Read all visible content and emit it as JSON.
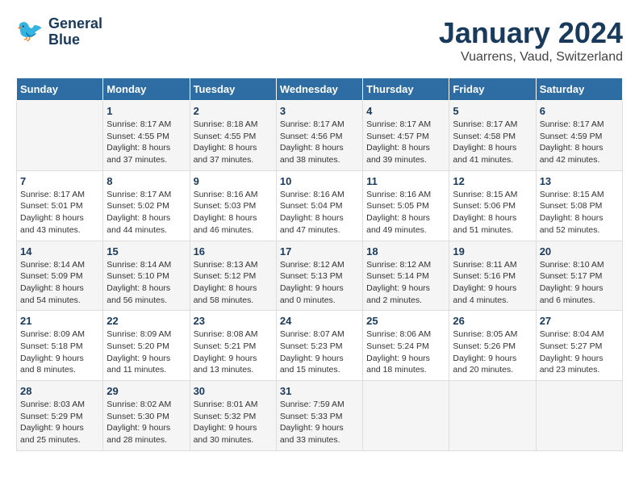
{
  "header": {
    "logo_line1": "General",
    "logo_line2": "Blue",
    "month": "January 2024",
    "location": "Vuarrens, Vaud, Switzerland"
  },
  "days_of_week": [
    "Sunday",
    "Monday",
    "Tuesday",
    "Wednesday",
    "Thursday",
    "Friday",
    "Saturday"
  ],
  "weeks": [
    [
      {
        "day": "",
        "info": ""
      },
      {
        "day": "1",
        "info": "Sunrise: 8:17 AM\nSunset: 4:55 PM\nDaylight: 8 hours\nand 37 minutes."
      },
      {
        "day": "2",
        "info": "Sunrise: 8:18 AM\nSunset: 4:55 PM\nDaylight: 8 hours\nand 37 minutes."
      },
      {
        "day": "3",
        "info": "Sunrise: 8:17 AM\nSunset: 4:56 PM\nDaylight: 8 hours\nand 38 minutes."
      },
      {
        "day": "4",
        "info": "Sunrise: 8:17 AM\nSunset: 4:57 PM\nDaylight: 8 hours\nand 39 minutes."
      },
      {
        "day": "5",
        "info": "Sunrise: 8:17 AM\nSunset: 4:58 PM\nDaylight: 8 hours\nand 41 minutes."
      },
      {
        "day": "6",
        "info": "Sunrise: 8:17 AM\nSunset: 4:59 PM\nDaylight: 8 hours\nand 42 minutes."
      }
    ],
    [
      {
        "day": "7",
        "info": "Sunrise: 8:17 AM\nSunset: 5:01 PM\nDaylight: 8 hours\nand 43 minutes."
      },
      {
        "day": "8",
        "info": "Sunrise: 8:17 AM\nSunset: 5:02 PM\nDaylight: 8 hours\nand 44 minutes."
      },
      {
        "day": "9",
        "info": "Sunrise: 8:16 AM\nSunset: 5:03 PM\nDaylight: 8 hours\nand 46 minutes."
      },
      {
        "day": "10",
        "info": "Sunrise: 8:16 AM\nSunset: 5:04 PM\nDaylight: 8 hours\nand 47 minutes."
      },
      {
        "day": "11",
        "info": "Sunrise: 8:16 AM\nSunset: 5:05 PM\nDaylight: 8 hours\nand 49 minutes."
      },
      {
        "day": "12",
        "info": "Sunrise: 8:15 AM\nSunset: 5:06 PM\nDaylight: 8 hours\nand 51 minutes."
      },
      {
        "day": "13",
        "info": "Sunrise: 8:15 AM\nSunset: 5:08 PM\nDaylight: 8 hours\nand 52 minutes."
      }
    ],
    [
      {
        "day": "14",
        "info": "Sunrise: 8:14 AM\nSunset: 5:09 PM\nDaylight: 8 hours\nand 54 minutes."
      },
      {
        "day": "15",
        "info": "Sunrise: 8:14 AM\nSunset: 5:10 PM\nDaylight: 8 hours\nand 56 minutes."
      },
      {
        "day": "16",
        "info": "Sunrise: 8:13 AM\nSunset: 5:12 PM\nDaylight: 8 hours\nand 58 minutes."
      },
      {
        "day": "17",
        "info": "Sunrise: 8:12 AM\nSunset: 5:13 PM\nDaylight: 9 hours\nand 0 minutes."
      },
      {
        "day": "18",
        "info": "Sunrise: 8:12 AM\nSunset: 5:14 PM\nDaylight: 9 hours\nand 2 minutes."
      },
      {
        "day": "19",
        "info": "Sunrise: 8:11 AM\nSunset: 5:16 PM\nDaylight: 9 hours\nand 4 minutes."
      },
      {
        "day": "20",
        "info": "Sunrise: 8:10 AM\nSunset: 5:17 PM\nDaylight: 9 hours\nand 6 minutes."
      }
    ],
    [
      {
        "day": "21",
        "info": "Sunrise: 8:09 AM\nSunset: 5:18 PM\nDaylight: 9 hours\nand 8 minutes."
      },
      {
        "day": "22",
        "info": "Sunrise: 8:09 AM\nSunset: 5:20 PM\nDaylight: 9 hours\nand 11 minutes."
      },
      {
        "day": "23",
        "info": "Sunrise: 8:08 AM\nSunset: 5:21 PM\nDaylight: 9 hours\nand 13 minutes."
      },
      {
        "day": "24",
        "info": "Sunrise: 8:07 AM\nSunset: 5:23 PM\nDaylight: 9 hours\nand 15 minutes."
      },
      {
        "day": "25",
        "info": "Sunrise: 8:06 AM\nSunset: 5:24 PM\nDaylight: 9 hours\nand 18 minutes."
      },
      {
        "day": "26",
        "info": "Sunrise: 8:05 AM\nSunset: 5:26 PM\nDaylight: 9 hours\nand 20 minutes."
      },
      {
        "day": "27",
        "info": "Sunrise: 8:04 AM\nSunset: 5:27 PM\nDaylight: 9 hours\nand 23 minutes."
      }
    ],
    [
      {
        "day": "28",
        "info": "Sunrise: 8:03 AM\nSunset: 5:29 PM\nDaylight: 9 hours\nand 25 minutes."
      },
      {
        "day": "29",
        "info": "Sunrise: 8:02 AM\nSunset: 5:30 PM\nDaylight: 9 hours\nand 28 minutes."
      },
      {
        "day": "30",
        "info": "Sunrise: 8:01 AM\nSunset: 5:32 PM\nDaylight: 9 hours\nand 30 minutes."
      },
      {
        "day": "31",
        "info": "Sunrise: 7:59 AM\nSunset: 5:33 PM\nDaylight: 9 hours\nand 33 minutes."
      },
      {
        "day": "",
        "info": ""
      },
      {
        "day": "",
        "info": ""
      },
      {
        "day": "",
        "info": ""
      }
    ]
  ]
}
